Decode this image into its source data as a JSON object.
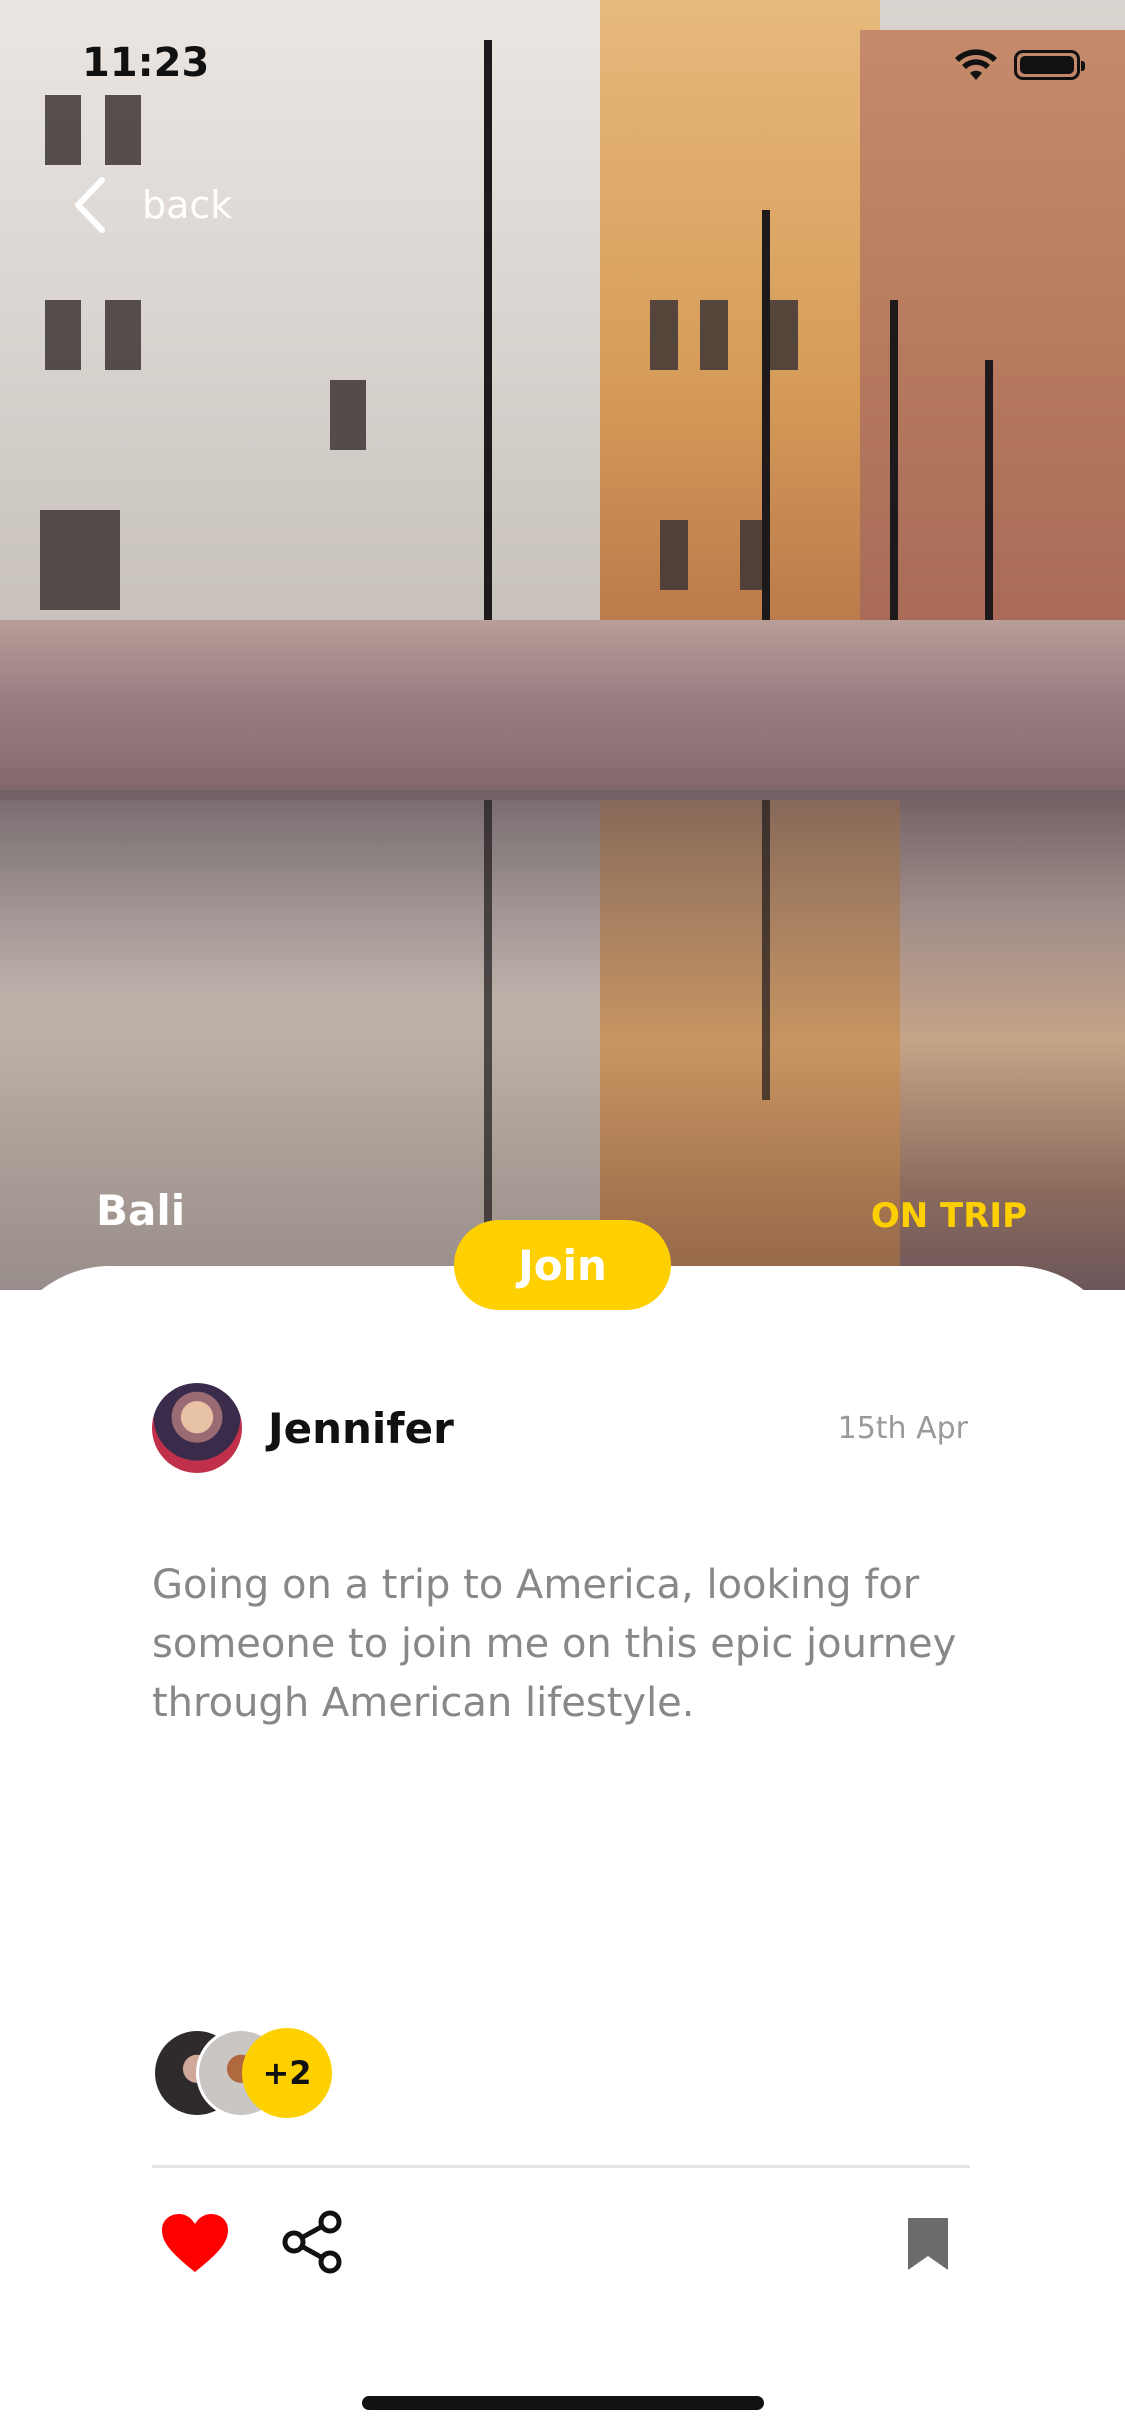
{
  "status_bar": {
    "time": "11:23"
  },
  "nav": {
    "back_label": "back"
  },
  "trip": {
    "location": "Bali",
    "status": "ON TRIP",
    "join_label": "Join",
    "author": "Jennifer",
    "date": "15th Apr",
    "description": "Going on a trip to America, looking for someone to join me on this epic journey through American lifestyle.",
    "participants_more": "+2"
  },
  "colors": {
    "accent": "#FFD000",
    "like": "#FF0000",
    "text_muted": "#888888"
  },
  "icons": [
    "back-chevron-icon",
    "wifi-icon",
    "battery-icon",
    "heart-icon",
    "share-icon",
    "bookmark-icon"
  ]
}
